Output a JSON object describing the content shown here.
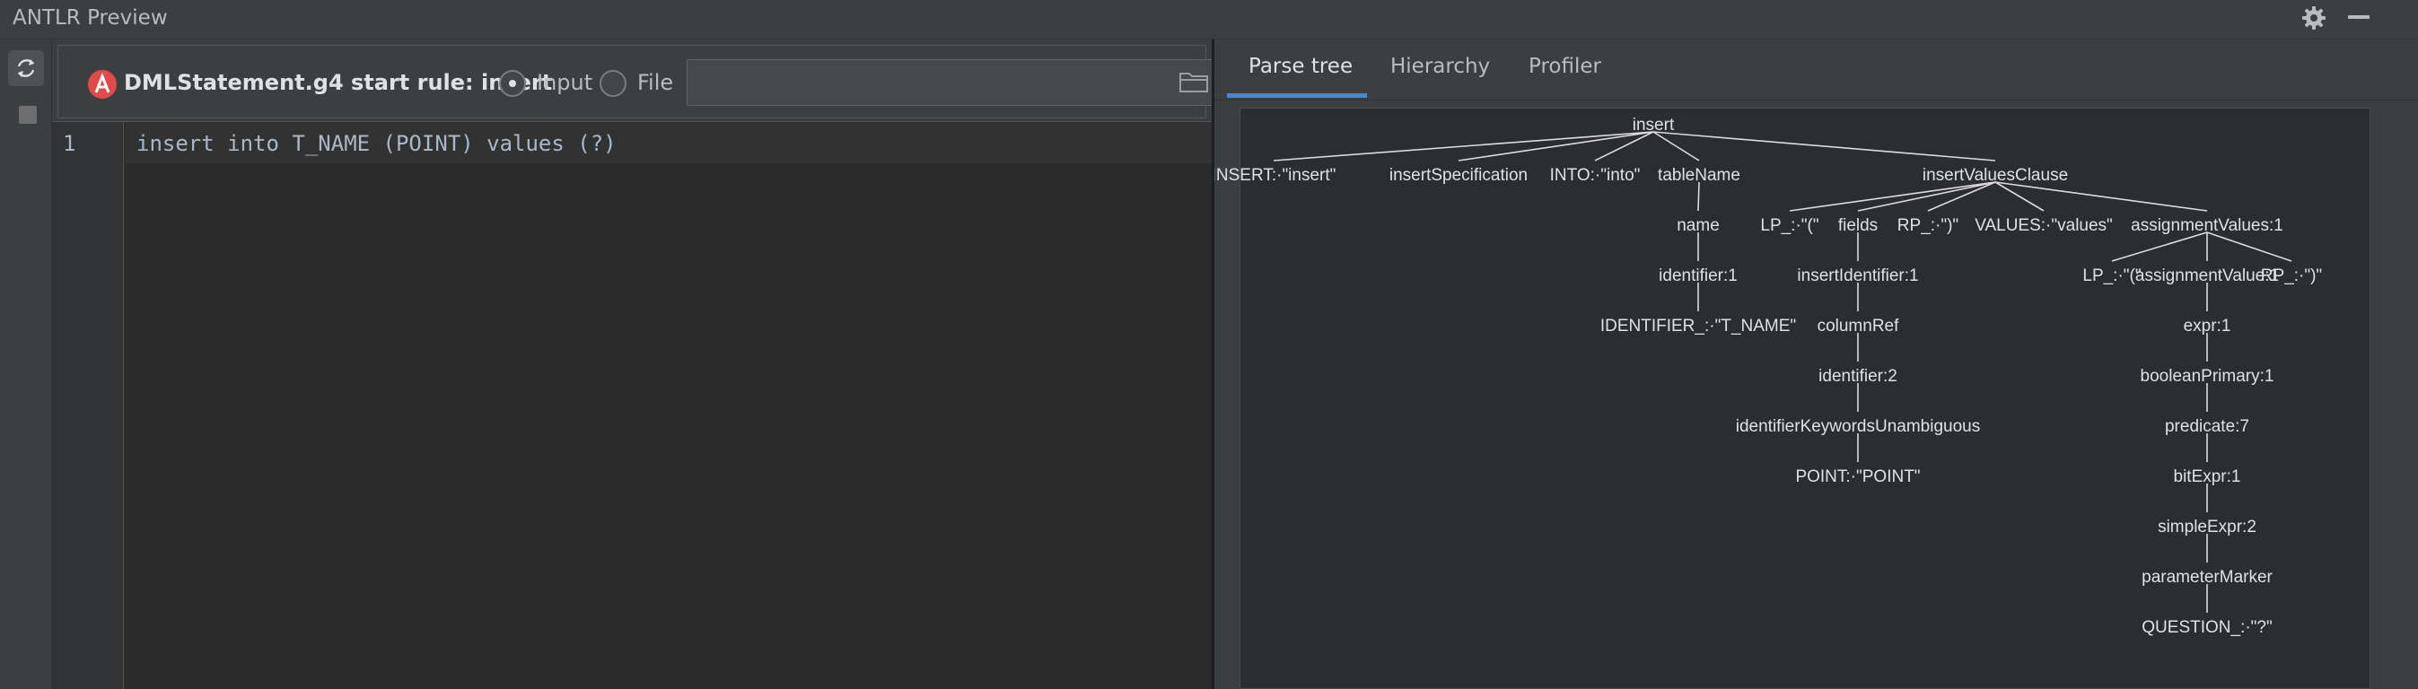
{
  "window": {
    "title": "ANTLR Preview"
  },
  "rule_bar": {
    "label": "DMLStatement.g4 start rule: insert",
    "input_label": "Input",
    "file_label": "File",
    "file_path": "",
    "selected": "Input"
  },
  "editor": {
    "line_number": "1",
    "code": "insert into T_NAME (POINT) values (?)"
  },
  "tabs": [
    "Parse tree",
    "Hierarchy",
    "Profiler"
  ],
  "active_tab": "Parse tree",
  "tree": {
    "nodes": [
      {
        "id": "n0",
        "label": "insert"
      },
      {
        "id": "n1",
        "label": "INSERT:·\"insert\"",
        "parent": "n0"
      },
      {
        "id": "n2",
        "label": "insertSpecification",
        "parent": "n0"
      },
      {
        "id": "n3",
        "label": "INTO:·\"into\"",
        "parent": "n0"
      },
      {
        "id": "n4",
        "label": "tableName",
        "parent": "n0"
      },
      {
        "id": "n5",
        "label": "insertValuesClause",
        "parent": "n0"
      },
      {
        "id": "n6",
        "label": "name",
        "parent": "n4"
      },
      {
        "id": "n7",
        "label": "identifier:1",
        "parent": "n6"
      },
      {
        "id": "n8",
        "label": "IDENTIFIER_:·\"T_NAME\"",
        "parent": "n7"
      },
      {
        "id": "n9",
        "label": "LP_:·\"(\"",
        "parent": "n5"
      },
      {
        "id": "n10",
        "label": "fields",
        "parent": "n5"
      },
      {
        "id": "n11",
        "label": "RP_:·\")\"",
        "parent": "n5"
      },
      {
        "id": "n12",
        "label": "VALUES:·\"values\"",
        "parent": "n5"
      },
      {
        "id": "n13",
        "label": "assignmentValues:1",
        "parent": "n5"
      },
      {
        "id": "n14",
        "label": "insertIdentifier:1",
        "parent": "n10"
      },
      {
        "id": "n15",
        "label": "columnRef",
        "parent": "n14"
      },
      {
        "id": "n16",
        "label": "identifier:2",
        "parent": "n15"
      },
      {
        "id": "n17",
        "label": "identifierKeywordsUnambiguous",
        "parent": "n16"
      },
      {
        "id": "n18",
        "label": "POINT:·\"POINT\"",
        "parent": "n17"
      },
      {
        "id": "n19",
        "label": "LP_:·\"(\"",
        "parent": "n13"
      },
      {
        "id": "n20",
        "label": "assignmentValue:1",
        "parent": "n13"
      },
      {
        "id": "n21",
        "label": "RP_:·\")\"",
        "parent": "n13"
      },
      {
        "id": "n22",
        "label": "expr:1",
        "parent": "n20"
      },
      {
        "id": "n23",
        "label": "booleanPrimary:1",
        "parent": "n22"
      },
      {
        "id": "n24",
        "label": "predicate:7",
        "parent": "n23"
      },
      {
        "id": "n25",
        "label": "bitExpr:1",
        "parent": "n24"
      },
      {
        "id": "n26",
        "label": "simpleExpr:2",
        "parent": "n25"
      },
      {
        "id": "n27",
        "label": "parameterMarker",
        "parent": "n26"
      },
      {
        "id": "n28",
        "label": "QUESTION_:·\"?\"",
        "parent": "n27"
      }
    ]
  }
}
